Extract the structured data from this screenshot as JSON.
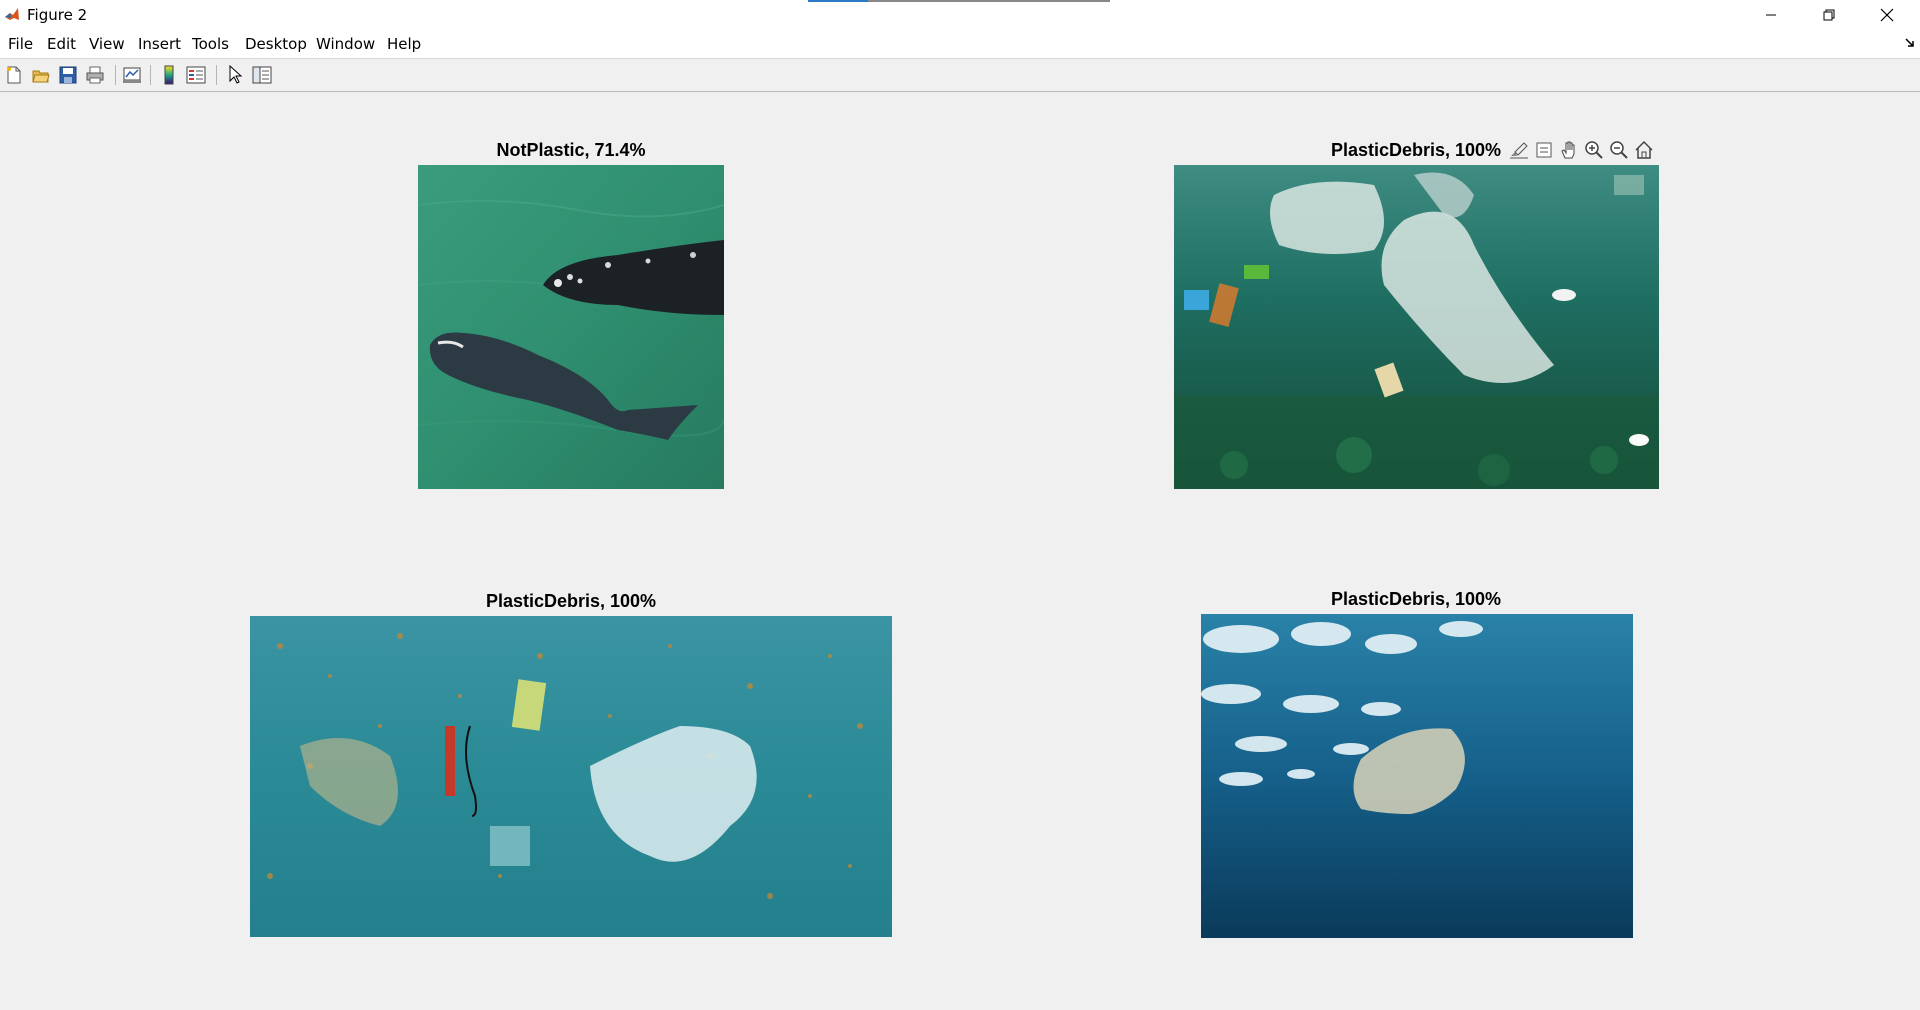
{
  "window": {
    "title": "Figure 2",
    "controls": [
      "minimize",
      "restore",
      "close"
    ]
  },
  "menu": {
    "items": [
      {
        "label": "File"
      },
      {
        "label": "Edit"
      },
      {
        "label": "View"
      },
      {
        "label": "Insert"
      },
      {
        "label": "Tools"
      },
      {
        "label": "Desktop"
      },
      {
        "label": "Window"
      },
      {
        "label": "Help"
      }
    ]
  },
  "toolbar": {
    "icons": [
      "new-figure-icon",
      "open-file-icon",
      "save-icon",
      "print-icon",
      "link-plot-icon",
      "colorbar-icon",
      "legend-icon",
      "edit-plot-icon",
      "property-inspector-icon"
    ]
  },
  "axes_toolbar": {
    "icons": [
      "brush-icon",
      "data-tips-icon",
      "pan-icon",
      "zoom-in-icon",
      "zoom-out-icon",
      "restore-view-icon"
    ]
  },
  "figure": {
    "panels": [
      {
        "title": "NotPlastic, 71.4%",
        "image": "aerial view of two whales in green water"
      },
      {
        "title": "PlasticDebris, 100%",
        "image": "plastic bags floating underwater in green sea"
      },
      {
        "title": "PlasticDebris, 100%",
        "image": "plastic bag and debris floating in turquoise water"
      },
      {
        "title": "PlasticDebris, 100%",
        "image": "plastic bag floating in deep blue ocean below surface"
      }
    ]
  },
  "colors": {
    "figure_background": "#f0f0f0",
    "titlebar": "#ffffff",
    "accent": "#2a7ac7"
  }
}
